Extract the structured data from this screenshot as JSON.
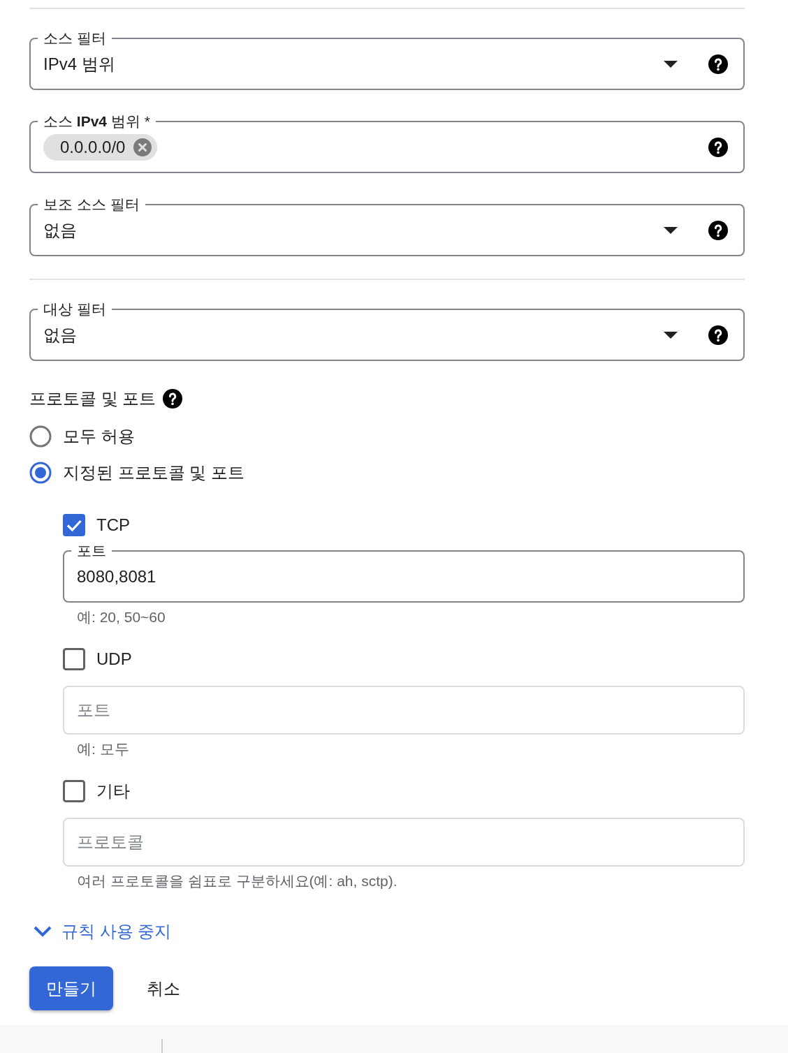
{
  "source_fields": [
    {
      "kind": "select",
      "label": "소스 필터",
      "value": "IPv4 범위"
    },
    {
      "kind": "chips",
      "label": "소스 **IPv4** 범위 *",
      "chips": [
        "0.0.0.0/0"
      ]
    },
    {
      "kind": "select",
      "label": "보조 소스 필터",
      "value": "없음"
    }
  ],
  "target_fields": [
    {
      "kind": "select",
      "label": "대상 필터",
      "value": "없음"
    }
  ],
  "protocols_ports": {
    "title": "프로토콜 및 포트",
    "options": [
      {
        "label": "모두 허용",
        "selected": false
      },
      {
        "label": "지정된 프로토콜 및 포트",
        "selected": true
      }
    ],
    "protocols": [
      {
        "label": "TCP",
        "checked": true,
        "field": {
          "label": "포트",
          "value": "8080,8081",
          "disabled": false
        },
        "hint": "예: 20, 50~60"
      },
      {
        "label": "UDP",
        "checked": false,
        "field": {
          "placeholder": "포트",
          "disabled": true
        },
        "hint": "예: 모두"
      },
      {
        "label": "기타",
        "checked": false,
        "field": {
          "placeholder": "프로토콜",
          "disabled": true
        },
        "hint": "여러 프로토콜을 쉼표로 구분하세요(예: ah, sctp)."
      }
    ]
  },
  "disable_rule_link": {
    "label": "규칙 사용 중지"
  },
  "buttons": [
    {
      "label": "만들기",
      "kind": "primary"
    },
    {
      "label": "취소",
      "kind": "text"
    }
  ]
}
